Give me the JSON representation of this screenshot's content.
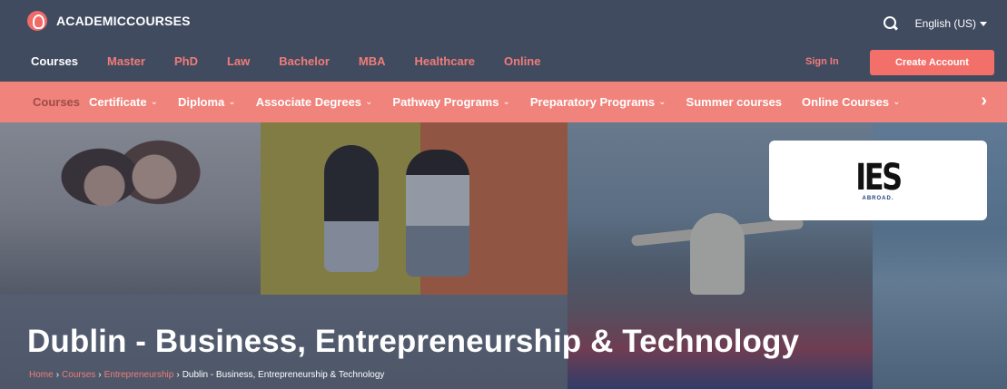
{
  "brand": {
    "name": "ACADEMICCOURSES",
    "icon": "academiccourses-logo-icon",
    "accent": "#f36f69",
    "nav_bg": "#414b60",
    "subnav_bg": "#f0837b"
  },
  "header": {
    "language": "English (US)",
    "sign_in": "Sign In",
    "create_account": "Create Account"
  },
  "main_nav": [
    {
      "label": "Courses",
      "active": true
    },
    {
      "label": "Master"
    },
    {
      "label": "PhD"
    },
    {
      "label": "Law"
    },
    {
      "label": "Bachelor"
    },
    {
      "label": "MBA"
    },
    {
      "label": "Healthcare"
    },
    {
      "label": "Online"
    }
  ],
  "sub_nav": {
    "active": "Courses",
    "items": [
      {
        "label": "Certificate",
        "chevron": "⌄"
      },
      {
        "label": "Diploma",
        "chevron": "⌄"
      },
      {
        "label": "Associate Degrees",
        "chevron": "⌄"
      },
      {
        "label": "Pathway Programs",
        "chevron": "⌄"
      },
      {
        "label": "Preparatory Programs",
        "chevron": "⌄"
      },
      {
        "label": "Summer courses"
      },
      {
        "label": "Online Courses",
        "chevron": "⌄"
      }
    ],
    "next_arrow": "›"
  },
  "hero": {
    "title": "Dublin - Business, Entrepreneurship & Technology",
    "school_logo": {
      "main": "IES",
      "sub": "ABROAD."
    },
    "breadcrumb": [
      "Home",
      "Courses",
      "Entrepreneurship",
      "Dublin - Business, Entrepreneurship & Technology"
    ],
    "breadcrumb_sep": "›"
  }
}
